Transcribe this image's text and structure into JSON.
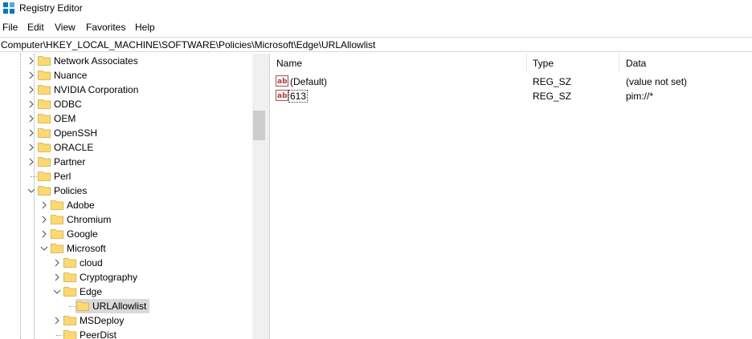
{
  "window": {
    "title": "Registry Editor",
    "icon": "registry-editor-icon",
    "accent": "#0078d7"
  },
  "menu": [
    "File",
    "Edit",
    "View",
    "Favorites",
    "Help"
  ],
  "address": "Computer\\HKEY_LOCAL_MACHINE\\SOFTWARE\\Policies\\Microsoft\\Edge\\URLAllowlist",
  "tree": {
    "items": [
      {
        "label": "Network Associates",
        "expander": "collapsed"
      },
      {
        "label": "Nuance",
        "expander": "collapsed"
      },
      {
        "label": "NVIDIA Corporation",
        "expander": "collapsed"
      },
      {
        "label": "ODBC",
        "expander": "collapsed"
      },
      {
        "label": "OEM",
        "expander": "collapsed"
      },
      {
        "label": "OpenSSH",
        "expander": "collapsed"
      },
      {
        "label": "ORACLE",
        "expander": "collapsed"
      },
      {
        "label": "Partner",
        "expander": "collapsed"
      },
      {
        "label": "Perl",
        "expander": "none"
      },
      {
        "label": "Policies",
        "expander": "expanded"
      },
      {
        "label": "Adobe",
        "expander": "collapsed"
      },
      {
        "label": "Chromium",
        "expander": "collapsed"
      },
      {
        "label": "Google",
        "expander": "collapsed"
      },
      {
        "label": "Microsoft",
        "expander": "expanded"
      },
      {
        "label": "cloud",
        "expander": "collapsed"
      },
      {
        "label": "Cryptography",
        "expander": "collapsed"
      },
      {
        "label": "Edge",
        "expander": "expanded"
      },
      {
        "label": "URLAllowlist",
        "expander": "none",
        "selected": true
      },
      {
        "label": "MSDeploy",
        "expander": "collapsed"
      },
      {
        "label": "PeerDist",
        "expander": "none"
      }
    ],
    "folder_color": "#ffd86e",
    "selected_bg": "#d9d9d9"
  },
  "list": {
    "columns": [
      "Name",
      "Type",
      "Data"
    ],
    "rows": [
      {
        "name": "(Default)",
        "type": "REG_SZ",
        "data": "(value not set)",
        "icon": "string-value-icon"
      },
      {
        "name": "613",
        "type": "REG_SZ",
        "data": "pim://*",
        "icon": "string-value-icon"
      }
    ]
  }
}
